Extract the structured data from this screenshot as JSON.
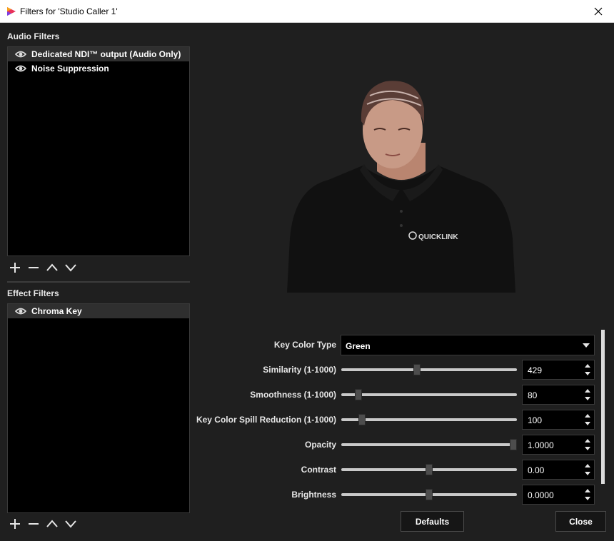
{
  "window": {
    "title": "Filters for 'Studio Caller 1'"
  },
  "audio_filters": {
    "label": "Audio Filters",
    "items": [
      {
        "label": "Dedicated NDI™ output (Audio Only)",
        "selected": true
      },
      {
        "label": "Noise Suppression",
        "selected": false
      }
    ]
  },
  "effect_filters": {
    "label": "Effect Filters",
    "items": [
      {
        "label": "Chroma Key",
        "selected": true
      }
    ]
  },
  "toolbar_icons": [
    "plus-icon",
    "minus-icon",
    "chevron-up-icon",
    "chevron-down-icon"
  ],
  "properties": {
    "key_color_type": {
      "label": "Key Color Type",
      "value": "Green"
    },
    "similarity": {
      "label": "Similarity (1-1000)",
      "value": "429",
      "level": 0.429
    },
    "smoothness": {
      "label": "Smoothness (1-1000)",
      "value": "80",
      "level": 0.08
    },
    "spill": {
      "label": "Key Color Spill Reduction (1-1000)",
      "value": "100",
      "level": 0.1
    },
    "opacity": {
      "label": "Opacity",
      "value": "1.0000",
      "level": 1.0
    },
    "contrast": {
      "label": "Contrast",
      "value": "0.00",
      "level": 0.5
    },
    "brightness": {
      "label": "Brightness",
      "value": "0.0000",
      "level": 0.5
    }
  },
  "buttons": {
    "defaults": "Defaults",
    "close": "Close"
  },
  "preview": {
    "shirt_logo": "QUICKLINK"
  }
}
